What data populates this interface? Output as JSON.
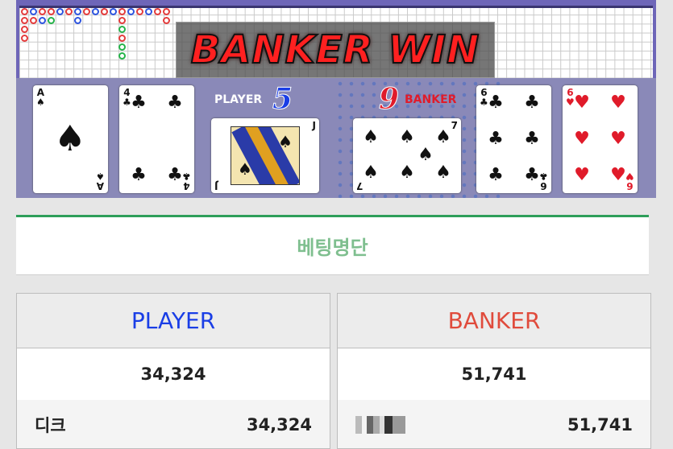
{
  "game": {
    "result_banner": "BANKER WIN",
    "player": {
      "label": "PLAYER",
      "score": "5"
    },
    "banker": {
      "label": "BANKER",
      "score": "9"
    },
    "cards": {
      "player": [
        {
          "rank": "A",
          "suit": "♠",
          "color": "black"
        },
        {
          "rank": "4",
          "suit": "♣",
          "color": "black"
        },
        {
          "rank": "J",
          "suit": "♠",
          "color": "black"
        }
      ],
      "banker": [
        {
          "rank": "7",
          "suit": "♠",
          "color": "black"
        },
        {
          "rank": "6",
          "suit": "♣",
          "color": "black"
        },
        {
          "rank": "6",
          "suit": "♥",
          "color": "red"
        }
      ]
    }
  },
  "betting_list": {
    "title": "베팅명단",
    "player": {
      "header": "PLAYER",
      "total": "34,324",
      "rows": [
        {
          "name": "디크",
          "amount": "34,324"
        }
      ]
    },
    "banker": {
      "header": "BANKER",
      "total": "51,741",
      "rows": [
        {
          "name": "",
          "amount": "51,741"
        }
      ]
    }
  },
  "colors": {
    "player_blue": "#1a3ee6",
    "banker_red": "#e04b3c",
    "accent_green": "#2e9e5a",
    "banner_red": "#ff2020"
  }
}
